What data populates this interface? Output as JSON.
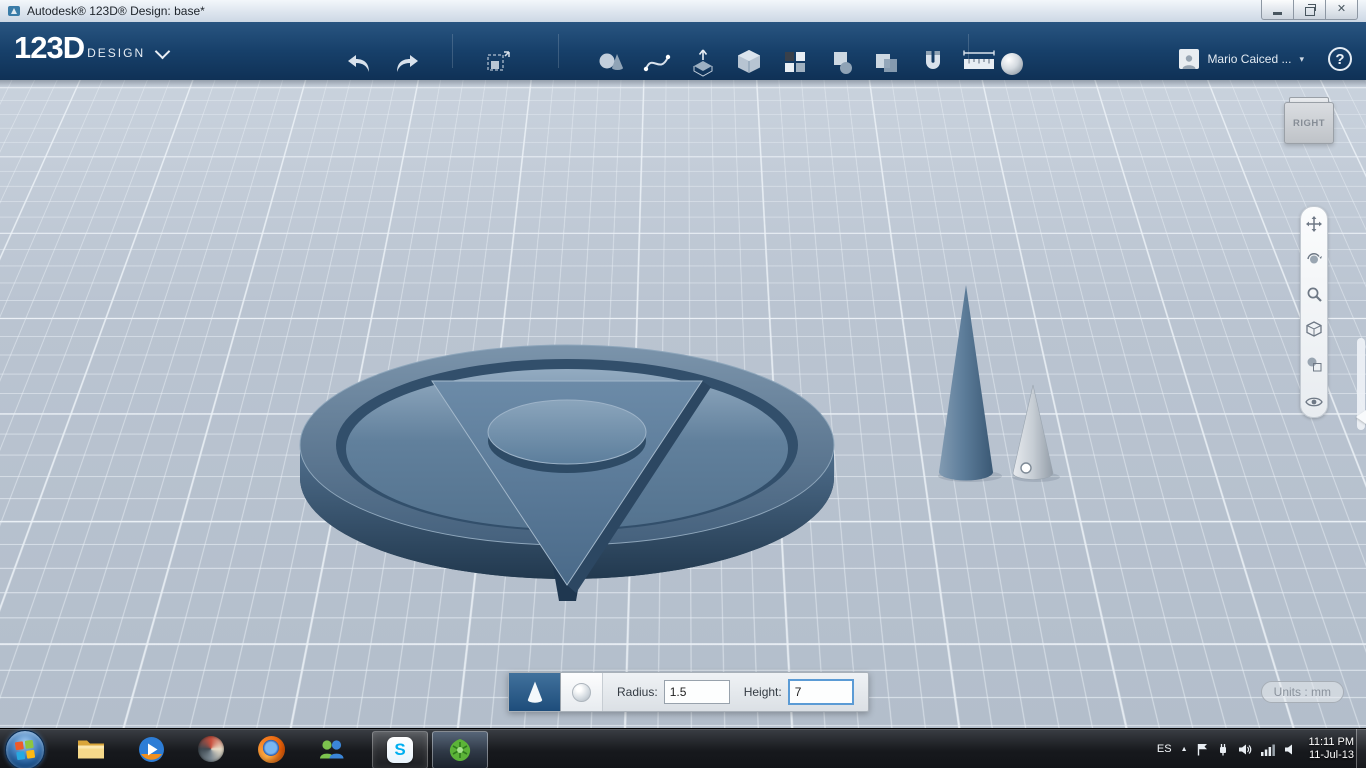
{
  "window": {
    "title": "Autodesk® 123D® Design: base*"
  },
  "appbar": {
    "logo": "123D",
    "logo_sub": "DESIGN",
    "user_name": "Mario Caiced ...",
    "user_dropdown_glyph": "▾",
    "help_glyph": "?",
    "close_glyph": "✕",
    "toolbar_icons": [
      "undo-icon",
      "redo-icon",
      "transform-icon",
      "primitives-icon",
      "sketch-icon",
      "construct-icon",
      "modify-icon",
      "pattern-icon",
      "grouping-icon",
      "combine-icon",
      "snap-icon",
      "measure-icon",
      "material-icon"
    ],
    "nav_icons": [
      "pan-icon",
      "orbit-icon",
      "zoom-icon",
      "fit-icon",
      "view-settings-icon",
      "visibility-icon"
    ]
  },
  "viewport": {
    "view_cube_label": "RIGHT",
    "units_label": "Units : mm",
    "model_color": "#587695",
    "selection_dot": "white snap point on light cone"
  },
  "prompt_bar": {
    "selected_primitive": "cone",
    "radius_label": "Radius:",
    "radius_value": "1.5",
    "height_label": "Height:",
    "height_value": "7"
  },
  "taskbar": {
    "language_indicator": "ES",
    "tray_expand_glyph": "▲",
    "clock_time": "11:11 PM",
    "clock_date": "11-Jul-13"
  },
  "colors": {
    "appbar_blue": "#17406a",
    "viewport_bg": "#bac4d1",
    "cone_button_blue": "#1e4d7b",
    "skype_blue": "#00aff0",
    "input_focus_blue": "#5b9bd5"
  }
}
